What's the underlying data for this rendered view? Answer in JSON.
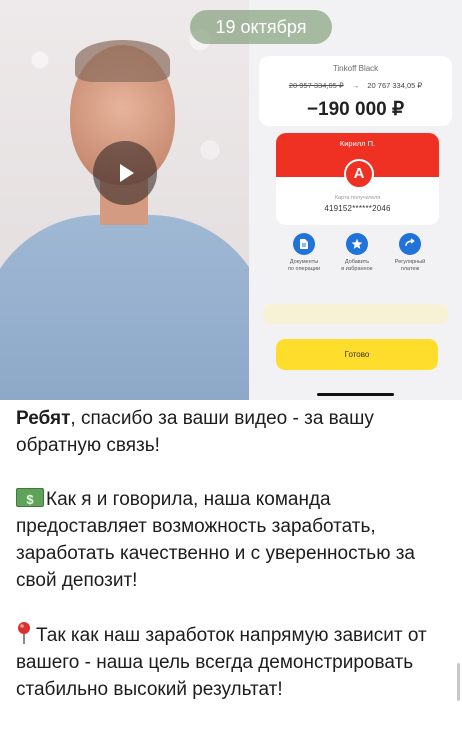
{
  "date_badge": "19 октября",
  "video": {
    "play_icon": "play-icon"
  },
  "bank_screen": {
    "card_title": "Tinkoff Black",
    "balance_before": "20 957 334,05 ₽",
    "arrow": "→",
    "balance_after": "20 767 334,05 ₽",
    "amount": "−190 000 ₽",
    "recipient_name": "Кирилл П.",
    "bank_logo_letter": "А",
    "card_label": "Карта получателя",
    "card_number": "419152******2046",
    "actions": [
      {
        "icon": "document-icon",
        "label_line1": "Документы",
        "label_line2": "по операции"
      },
      {
        "icon": "star-icon",
        "label_line1": "Добавить",
        "label_line2": "в избранное"
      },
      {
        "icon": "repeat-icon",
        "label_line1": "Регулярный",
        "label_line2": "платеж"
      }
    ],
    "done_button": "Готово",
    "accent_colors": {
      "bank_red": "#ef3124",
      "tinkoff_yellow": "#ffdd2d",
      "action_blue": "#1f73d9"
    }
  },
  "caption": {
    "p1_bold": "Ребят",
    "p1_rest": ", спасибо за ваши видео - за вашу обратную связь!",
    "p2_icon": "money-emoji-icon",
    "p2": "Как я и говорила, наша команда предоставляет возможность заработать, заработать качественно и с уверенностью за свой депозит!",
    "p3_icon": "pushpin-emoji-icon",
    "p3": "Так как наш заработок напрямую зависит от вашего - наша цель всегда демонстрировать стабильно высокий результат!"
  }
}
